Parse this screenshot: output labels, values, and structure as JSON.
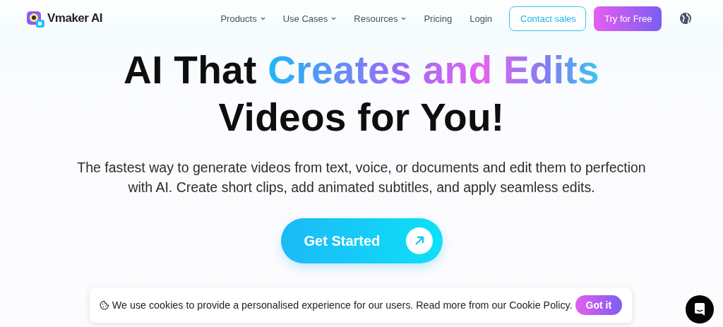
{
  "brand": {
    "name": "Vmaker AI"
  },
  "nav": {
    "items": [
      {
        "label": "Products",
        "dropdown": true
      },
      {
        "label": "Use Cases",
        "dropdown": true
      },
      {
        "label": "Resources",
        "dropdown": true
      },
      {
        "label": "Pricing",
        "dropdown": false
      },
      {
        "label": "Login",
        "dropdown": false
      }
    ],
    "buttons": [
      {
        "label": "Contact sales",
        "kind": "outline"
      },
      {
        "label": "Try for Free",
        "kind": "gradient"
      }
    ]
  },
  "hero": {
    "headline": [
      [
        {
          "text": "AI That ",
          "kind": "plain"
        },
        {
          "text": "Creates and Edits",
          "kind": "gradient"
        }
      ],
      [
        {
          "text": "Videos for You!",
          "kind": "plain"
        }
      ]
    ],
    "subtitle": "The fastest way to generate videos from text, voice, or documents and edit them to perfection with AI. Create short clips, add animated subtitles, and apply seamless edits.",
    "cta": "Get Started"
  },
  "cookie_banner": {
    "text": "We use cookies to provide a personalised experience for our users. Read more from our Cookie Policy.",
    "button": "Got it"
  }
}
